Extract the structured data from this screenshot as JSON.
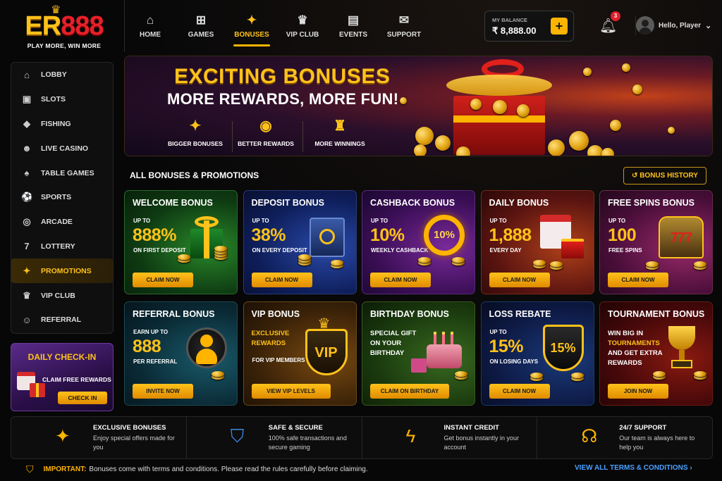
{
  "brand": {
    "name_a": "ER",
    "name_b": "888",
    "tagline": "PLAY MORE, WIN MORE"
  },
  "nav": [
    {
      "label": "HOME",
      "icon": "home-icon",
      "glyph": "⌂"
    },
    {
      "label": "GAMES",
      "icon": "gamepad-icon",
      "glyph": "⊞"
    },
    {
      "label": "BONUSES",
      "icon": "gift-icon",
      "glyph": "✦",
      "active": true
    },
    {
      "label": "VIP CLUB",
      "icon": "crown-icon",
      "glyph": "♛"
    },
    {
      "label": "EVENTS",
      "icon": "briefcase-icon",
      "glyph": "▤"
    },
    {
      "label": "SUPPORT",
      "icon": "mail-icon",
      "glyph": "✉"
    }
  ],
  "balance": {
    "label": "MY BALANCE",
    "value": "₹ 8,888.00"
  },
  "notifications": {
    "count": "3"
  },
  "user": {
    "greeting": "Hello, Player"
  },
  "sidebar": [
    {
      "label": "LOBBY",
      "glyph": "⌂",
      "icon": "lobby-icon"
    },
    {
      "label": "SLOTS",
      "glyph": "▣",
      "icon": "slots-icon"
    },
    {
      "label": "FISHING",
      "glyph": "◆",
      "icon": "fish-icon"
    },
    {
      "label": "LIVE CASINO",
      "glyph": "☻",
      "icon": "dealer-icon"
    },
    {
      "label": "TABLE GAMES",
      "glyph": "♠",
      "icon": "cards-icon"
    },
    {
      "label": "SPORTS",
      "glyph": "⚽",
      "icon": "ball-icon"
    },
    {
      "label": "ARCADE",
      "glyph": "◎",
      "icon": "joystick-icon"
    },
    {
      "label": "LOTTERY",
      "glyph": "7",
      "icon": "lottery-icon"
    },
    {
      "label": "PROMOTIONS",
      "glyph": "✦",
      "icon": "gift-icon",
      "active": true
    },
    {
      "label": "VIP CLUB",
      "glyph": "♛",
      "icon": "crown-icon"
    },
    {
      "label": "REFERRAL",
      "glyph": "☺",
      "icon": "people-icon"
    }
  ],
  "checkin": {
    "title": "DAILY CHECK-IN",
    "text": "CLAIM FREE REWARDS",
    "button": "CHECK IN"
  },
  "banner": {
    "title": "EXCITING BONUSES",
    "subtitle": "MORE REWARDS, MORE FUN!",
    "features": [
      {
        "label": "BIGGER BONUSES",
        "glyph": "✦",
        "icon": "gift-icon"
      },
      {
        "label": "BETTER REWARDS",
        "glyph": "◉",
        "icon": "coins-icon"
      },
      {
        "label": "MORE WINNINGS",
        "glyph": "♜",
        "icon": "trophy-icon"
      }
    ]
  },
  "section": {
    "title": "ALL BONUSES & PROMOTIONS",
    "history": "BONUS HISTORY"
  },
  "cards": [
    {
      "title": "WELCOME BONUS",
      "up": "UP TO",
      "big": "888%",
      "sub": "ON FIRST DEPOSIT",
      "button": "CLAIM NOW",
      "theme": "g-green",
      "art": "gift"
    },
    {
      "title": "DEPOSIT BONUS",
      "up": "UP TO",
      "big": "38%",
      "sub": "ON EVERY DEPOSIT",
      "button": "CLAIM NOW",
      "theme": "g-blue",
      "art": "safe"
    },
    {
      "title": "CASHBACK BONUS",
      "up": "UP TO",
      "big": "10%",
      "sub": "WEEKLY CASHBACK",
      "button": "CLAIM NOW",
      "theme": "g-purple",
      "art": "cashback",
      "art_text": "10%"
    },
    {
      "title": "DAILY BONUS",
      "up": "UP TO",
      "big": "1,888",
      "sub": "EVERY DAY",
      "button": "CLAIM NOW",
      "theme": "g-red",
      "art": "calendar"
    },
    {
      "title": "FREE SPINS BONUS",
      "up": "UP TO",
      "big": "100",
      "sub": "FREE SPINS",
      "button": "CLAIM NOW",
      "theme": "g-magenta",
      "art": "slot",
      "art_text": "777"
    },
    {
      "title": "REFERRAL BONUS",
      "up": "EARN UP TO",
      "big": "888",
      "sub": "PER REFERRAL",
      "button": "INVITE NOW",
      "theme": "g-teal",
      "art": "people"
    },
    {
      "title": "VIP BONUS",
      "desc": "EXCLUSIVE REWARDS",
      "sub": "FOR VIP MEMBERS",
      "button": "VIEW VIP LEVELS",
      "theme": "g-brown",
      "art": "vip",
      "art_text": "VIP"
    },
    {
      "title": "BIRTHDAY BONUS",
      "desc": "SPECIAL GIFT ON YOUR BIRTHDAY",
      "button": "CLAIM ON BIRTHDAY",
      "theme": "g-olive",
      "art": "cake"
    },
    {
      "title": "LOSS REBATE",
      "up": "UP TO",
      "big": "15%",
      "sub": "ON LOSING DAYS",
      "button": "CLAIM NOW",
      "theme": "g-navy",
      "art": "shield",
      "art_text": "15%"
    },
    {
      "title": "TOURNAMENT BONUS",
      "desc_parts": [
        "WIN BIG IN",
        "TOURNAMENTS",
        "AND GET EXTRA",
        "REWARDS"
      ],
      "button": "JOIN NOW",
      "theme": "g-crimson",
      "art": "trophy"
    }
  ],
  "features": [
    {
      "title": "EXCLUSIVE BONUSES",
      "desc": "Enjoy special offers made for you",
      "glyph": "✦",
      "icon": "gift-icon"
    },
    {
      "title": "SAFE & SECURE",
      "desc": "100% safe transactions and secure gaming",
      "glyph": "⛉",
      "icon": "shield-check-icon",
      "blue": true
    },
    {
      "title": "INSTANT CREDIT",
      "desc": "Get bonus instantly in your account",
      "glyph": "ϟ",
      "icon": "lightning-icon"
    },
    {
      "title": "24/7 SUPPORT",
      "desc": "Our team is always here to help you",
      "glyph": "☊",
      "icon": "headset-icon"
    }
  ],
  "notice": {
    "label": "IMPORTANT:",
    "text": "Bonuses come with terms and conditions. Please read the rules carefully before claiming.",
    "link": "VIEW ALL TERMS & CONDITIONS"
  },
  "colors": {
    "accent": "#ffb400",
    "brand_red": "#e8202a",
    "link": "#4aa0ff"
  }
}
